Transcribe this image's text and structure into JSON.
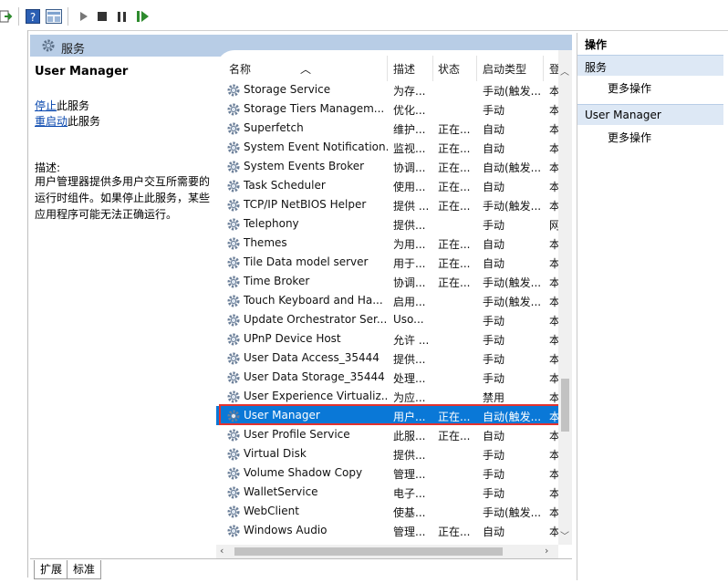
{
  "toolbar": {
    "icons": [
      "export-arrow-icon",
      "help-icon",
      "properties-icon",
      "start-service-icon",
      "stop-service-icon",
      "pause-service-icon",
      "restart-service-icon"
    ]
  },
  "services_header": {
    "title": "服务"
  },
  "description_pane": {
    "service_name": "User Manager",
    "stop_link": "停止",
    "stop_suffix": "此服务",
    "restart_link": "重启动",
    "restart_suffix": "此服务",
    "desc_label": "描述:",
    "desc_text": "用户管理器提供多用户交互所需要的运行时组件。如果停止此服务，某些应用程序可能无法正确运行。"
  },
  "columns": {
    "name": "名称",
    "description": "描述",
    "status": "状态",
    "startup": "启动类型",
    "logon": "登"
  },
  "services": [
    {
      "name": "Storage Service",
      "desc": "为存...",
      "status": "",
      "startup": "手动(触发...",
      "logon": "本"
    },
    {
      "name": "Storage Tiers Managem...",
      "desc": "优化...",
      "status": "",
      "startup": "手动",
      "logon": "本"
    },
    {
      "name": "Superfetch",
      "desc": "维护...",
      "status": "正在...",
      "startup": "自动",
      "logon": "本"
    },
    {
      "name": "System Event Notification...",
      "desc": "监视...",
      "status": "正在...",
      "startup": "自动",
      "logon": "本"
    },
    {
      "name": "System Events Broker",
      "desc": "协调...",
      "status": "正在...",
      "startup": "自动(触发...",
      "logon": "本"
    },
    {
      "name": "Task Scheduler",
      "desc": "使用...",
      "status": "正在...",
      "startup": "自动",
      "logon": "本"
    },
    {
      "name": "TCP/IP NetBIOS Helper",
      "desc": "提供 ...",
      "status": "正在...",
      "startup": "手动(触发...",
      "logon": "本"
    },
    {
      "name": "Telephony",
      "desc": "提供...",
      "status": "",
      "startup": "手动",
      "logon": "网"
    },
    {
      "name": "Themes",
      "desc": "为用...",
      "status": "正在...",
      "startup": "自动",
      "logon": "本"
    },
    {
      "name": "Tile Data model server",
      "desc": "用于...",
      "status": "正在...",
      "startup": "自动",
      "logon": "本"
    },
    {
      "name": "Time Broker",
      "desc": "协调...",
      "status": "正在...",
      "startup": "手动(触发...",
      "logon": "本"
    },
    {
      "name": "Touch Keyboard and Ha...",
      "desc": "启用...",
      "status": "",
      "startup": "手动(触发...",
      "logon": "本"
    },
    {
      "name": "Update Orchestrator Ser...",
      "desc": "Uso...",
      "status": "",
      "startup": "手动",
      "logon": "本"
    },
    {
      "name": "UPnP Device Host",
      "desc": "允许 ...",
      "status": "",
      "startup": "手动",
      "logon": "本"
    },
    {
      "name": "User Data Access_35444",
      "desc": "提供...",
      "status": "",
      "startup": "手动",
      "logon": "本"
    },
    {
      "name": "User Data Storage_35444",
      "desc": "处理...",
      "status": "",
      "startup": "手动",
      "logon": "本"
    },
    {
      "name": "User Experience Virtualiz...",
      "desc": "为应...",
      "status": "",
      "startup": "禁用",
      "logon": "本"
    },
    {
      "name": "User Manager",
      "desc": "用户...",
      "status": "正在...",
      "startup": "自动(触发...",
      "logon": "本",
      "selected": true
    },
    {
      "name": "User Profile Service",
      "desc": "此服...",
      "status": "正在...",
      "startup": "自动",
      "logon": "本"
    },
    {
      "name": "Virtual Disk",
      "desc": "提供...",
      "status": "",
      "startup": "手动",
      "logon": "本"
    },
    {
      "name": "Volume Shadow Copy",
      "desc": "管理...",
      "status": "",
      "startup": "手动",
      "logon": "本"
    },
    {
      "name": "WalletService",
      "desc": "电子...",
      "status": "",
      "startup": "手动",
      "logon": "本"
    },
    {
      "name": "WebClient",
      "desc": "使基...",
      "status": "",
      "startup": "手动(触发...",
      "logon": "本"
    },
    {
      "name": "Windows Audio",
      "desc": "管理...",
      "status": "正在...",
      "startup": "自动",
      "logon": "本"
    }
  ],
  "bottom_tabs": {
    "extended": "扩展",
    "standard": "标准"
  },
  "actions": {
    "header": "操作",
    "group1": "服务",
    "group1_item": "更多操作",
    "group2": "User Manager",
    "group2_item": "更多操作"
  },
  "colors": {
    "selection": "#0a78d7",
    "highlight_border": "#e3322f",
    "header_bg": "#b8cde6"
  }
}
